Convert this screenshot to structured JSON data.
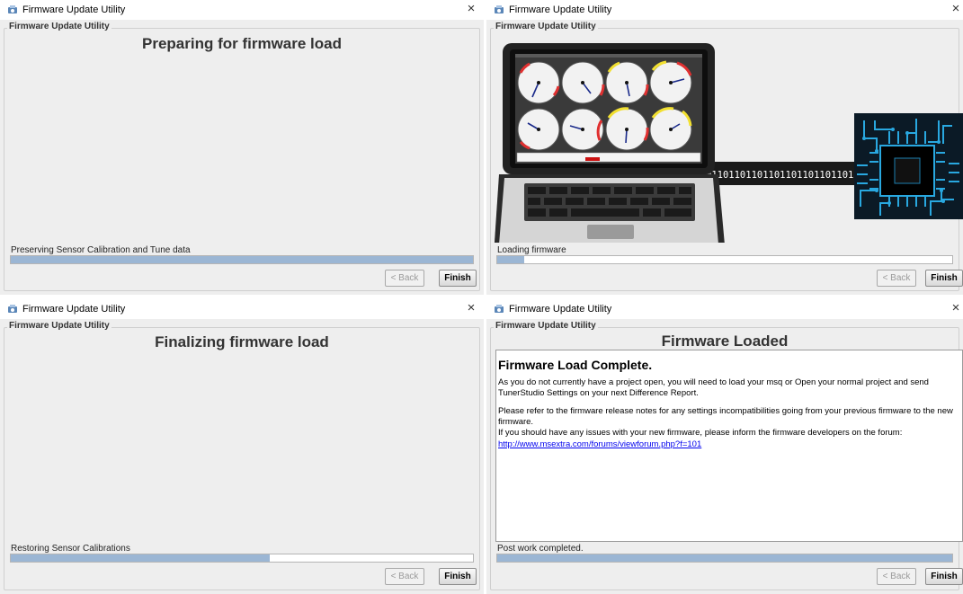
{
  "window_title": "Firmware Update Utility",
  "group_label": "Firmware Update Utility",
  "back_label": "< Back",
  "finish_label": "Finish",
  "close_glyph": "×",
  "panels": [
    {
      "headline": "Preparing for firmware load",
      "status": "Preserving Sensor Calibration and Tune data",
      "progress": 1.0
    },
    {
      "status": "Loading firmware",
      "progress": 0.06,
      "binary_text": "01101101101101101101101101101"
    },
    {
      "headline": "Finalizing firmware load",
      "status": "Restoring Sensor Calibrations",
      "progress": 0.56
    },
    {
      "headline": "Firmware Loaded",
      "status": "Post work completed.",
      "progress": 1.0,
      "content_title": "Firmware Load Complete.",
      "content_p1": "As you do not currently have a project open, you will need to load your msq or Open your normal project and send TunerStudio Settings on your next Difference Report.",
      "content_p2a": "Please refer to the firmware release notes for any settings incompatibilities going from your previous firmware to the new firmware.",
      "content_p2b": "If you should have any issues with your new firmware, please inform the firmware developers on the forum:",
      "content_link": "http://www.msextra.com/forums/viewforum.php?f=101"
    }
  ],
  "colors": {
    "panel_bg": "#eeeeee",
    "progress_fill": "#9bb6d4",
    "link": "#0000ee",
    "circuit": "#29a8e0"
  },
  "icons": {
    "app": "firmware-app-icon",
    "close": "close-icon"
  }
}
